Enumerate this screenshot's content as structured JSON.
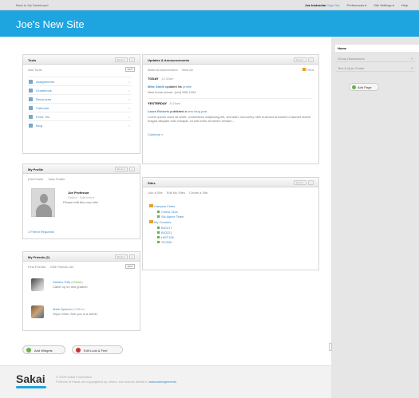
{
  "topbar": {
    "back": "Back to My Dashboard",
    "user": "Joe Instructor",
    "signout": "Sign Out",
    "preferences": "Preferences ▾",
    "site_settings": "Site Settings ▾",
    "help": "Help"
  },
  "banner": {
    "title": "Joe's New Site"
  },
  "nav": {
    "home": "Home",
    "items": [
      "Group Discussions",
      "Text & Quiz Center"
    ],
    "add_page": "Add Page"
  },
  "tools": {
    "title": "Tools",
    "menu": "Menu ▾",
    "add": "Add Tools",
    "edit": "EDIT",
    "items": [
      "Assignments",
      "Gradebook",
      "Resources",
      "Calendar",
      "Feed: Sio",
      "Blog"
    ]
  },
  "profile": {
    "title": "My Profile",
    "menu": "Menu ▾",
    "tabs": [
      "Edit Profile",
      "View Profile"
    ],
    "name": "Joe Professor",
    "sub": "Online · Edit Info ▾",
    "quote": "Please edit this new info!",
    "link": "1 Friend Requests"
  },
  "friends": {
    "title": "My Friends (2)",
    "menu": "Menu ▾",
    "tabs": [
      "Find Friends",
      "Edit Friends List"
    ],
    "edit": "EDIT",
    "list": [
      {
        "name": "Sandra Tully",
        "status": "(Online)",
        "msg": "Catch up on test grades!"
      },
      {
        "name": "Mark Spencer",
        "status": "(Offline)",
        "msg": "Hope Hello. See you in a week!"
      }
    ]
  },
  "bottom": {
    "add_widgets": "Add Widgets",
    "edit_look": "Edit Look & Feel"
  },
  "updates": {
    "title": "Updates & Announcements",
    "menu": "Menu ▾",
    "subnav": [
      "Make Announcement",
      "View All"
    ],
    "feed": "Feed",
    "date1": "TODAY",
    "date1_rest": "· 11:32am",
    "h1_who": "Mike Smith",
    "h1_mid": "updated his",
    "h1_what": "profile",
    "line1": "New home phone: (xxx) 555-1234",
    "date2": "YESTERDAY",
    "date2_rest": "· 8:15am",
    "h2_who": "Laura Roberts",
    "h2_mid": "published a",
    "h2_what": "new blog post",
    "para": "Lorem ipsum dolor sit amet, consectetur adipiscing elit, sed diam nonummy nibh euismod tincidunt ut laoreet dolore magna aliquam erat volutpat. Ut wisi enim ad minim veniam...",
    "continue": "Continue »"
  },
  "sites": {
    "title": "Sites",
    "menu": "Menu ▾",
    "subnav": [
      "Join a Site",
      "Edit My Sites",
      "Create a Site"
    ],
    "folders": [
      {
        "name": "Campus Clubs",
        "items": [
          "Chess Club",
          "Ski Alpine Team"
        ]
      },
      {
        "name": "My Courses",
        "items": [
          "BIO217",
          "BIO221",
          "HIST105",
          "SCI180"
        ]
      }
    ]
  },
  "footer": {
    "logo": "Sakai",
    "line1": "© 2009 Sakai Foundation",
    "line2_pre": "Portions of Sakai are copyrighted by others; see license details in",
    "line2_link": "acknowledgements"
  },
  "colors": {
    "accent": "#1ea5e0",
    "link": "#3c88c4",
    "online": "#6ab04c"
  }
}
